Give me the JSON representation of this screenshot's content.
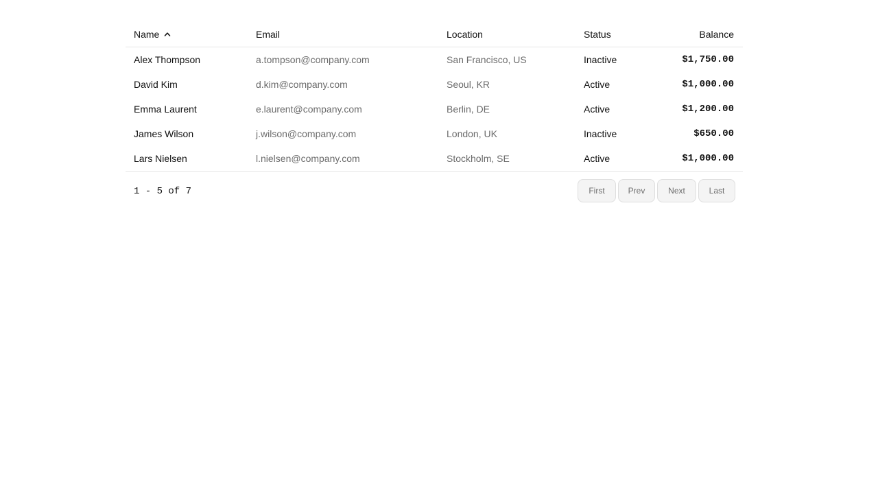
{
  "table": {
    "columns": {
      "name": "Name",
      "email": "Email",
      "location": "Location",
      "status": "Status",
      "balance": "Balance"
    },
    "sort": {
      "column": "name",
      "direction": "ascending",
      "icon": "chevron-up-icon"
    },
    "rows": [
      {
        "name": "Alex Thompson",
        "email": "a.tompson@company.com",
        "location": "San Francisco, US",
        "status": "Inactive",
        "balance": "$1,750.00"
      },
      {
        "name": "David Kim",
        "email": "d.kim@company.com",
        "location": "Seoul, KR",
        "status": "Active",
        "balance": "$1,000.00"
      },
      {
        "name": "Emma Laurent",
        "email": "e.laurent@company.com",
        "location": "Berlin, DE",
        "status": "Active",
        "balance": "$1,200.00"
      },
      {
        "name": "James Wilson",
        "email": "j.wilson@company.com",
        "location": "London, UK",
        "status": "Inactive",
        "balance": "$650.00"
      },
      {
        "name": "Lars Nielsen",
        "email": "l.nielsen@company.com",
        "location": "Stockholm, SE",
        "status": "Active",
        "balance": "$1,000.00"
      }
    ]
  },
  "pagination": {
    "range_text": "1 - 5 of 7",
    "first": "First",
    "prev": "Prev",
    "next": "Next",
    "last": "Last"
  },
  "colors": {
    "text_primary": "#111111",
    "text_muted": "#6b6b6b",
    "divider": "#e6e6e6",
    "button_bg": "#f4f4f4",
    "button_border": "#dedede"
  }
}
